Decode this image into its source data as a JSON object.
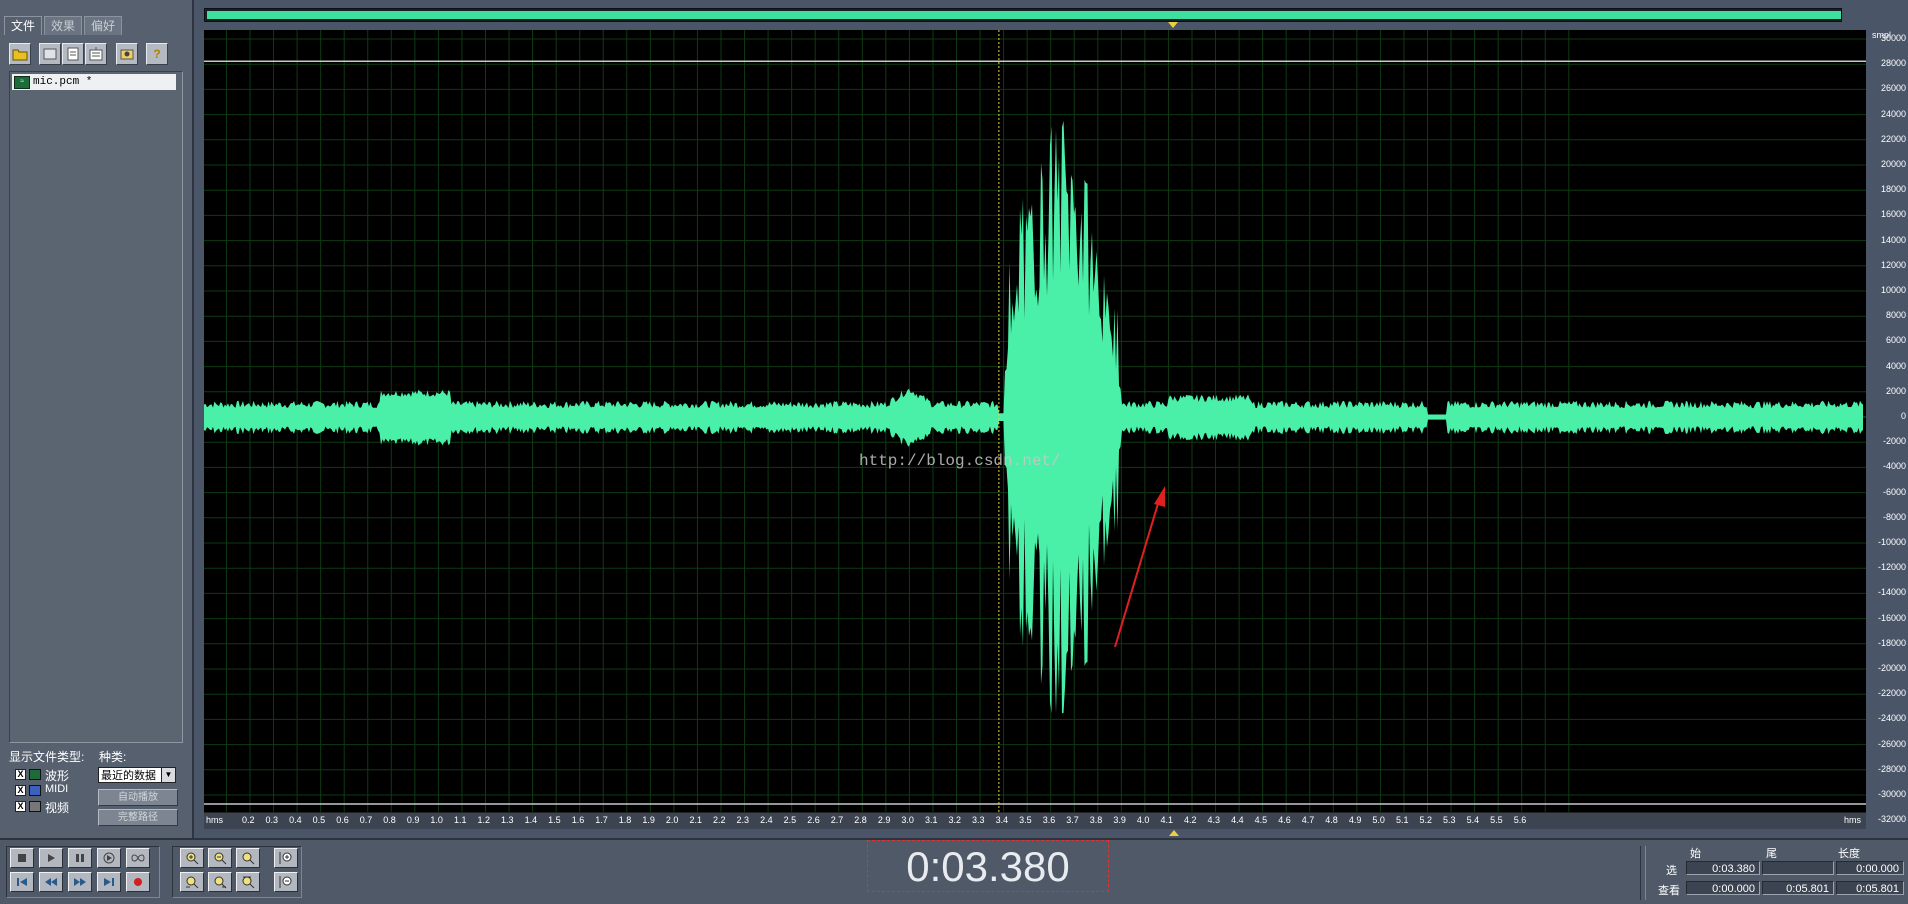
{
  "tabs": [
    "文件",
    "效果",
    "偏好"
  ],
  "toolbar_icons": [
    "open-folder-icon",
    "open-file-icon",
    "close-file-icon",
    "close-all-icon",
    "insert-icon",
    "help-icon"
  ],
  "files": [
    {
      "name": "mic.pcm *"
    }
  ],
  "filter": {
    "display_label": "显示文件类型:",
    "category_label": "种类:",
    "types": [
      {
        "label": "波形",
        "checked": "X"
      },
      {
        "label": "MIDI",
        "checked": "X"
      },
      {
        "label": "视频",
        "checked": "X"
      }
    ],
    "category_value": "最近的数据",
    "auto_play": "自动播放",
    "full_path": "完整路径"
  },
  "waveform": {
    "watermark": "http://blog.csdn.net/",
    "y_unit": "smpl",
    "y_ticks": [
      30000,
      28000,
      26000,
      24000,
      22000,
      20000,
      18000,
      16000,
      14000,
      12000,
      10000,
      8000,
      6000,
      4000,
      2000,
      0,
      -2000,
      -4000,
      -6000,
      -8000,
      -10000,
      -12000,
      -14000,
      -16000,
      -18000,
      -20000,
      -22000,
      -24000,
      -26000,
      -28000,
      -30000,
      -32000
    ],
    "x_unit": "hms",
    "x_ticks": [
      "0.2",
      "0.3",
      "0.4",
      "0.5",
      "0.6",
      "0.7",
      "0.8",
      "0.9",
      "1.0",
      "1.1",
      "1.2",
      "1.3",
      "1.4",
      "1.5",
      "1.6",
      "1.7",
      "1.8",
      "1.9",
      "2.0",
      "2.1",
      "2.2",
      "2.3",
      "2.4",
      "2.5",
      "2.6",
      "2.7",
      "2.8",
      "2.9",
      "3.0",
      "3.1",
      "3.2",
      "3.3",
      "3.4",
      "3.5",
      "3.6",
      "3.7",
      "3.8",
      "3.9",
      "4.0",
      "4.1",
      "4.2",
      "4.3",
      "4.4",
      "4.5",
      "4.6",
      "4.7",
      "4.8",
      "4.9",
      "5.0",
      "5.1",
      "5.2",
      "5.3",
      "5.4",
      "5.5",
      "5.6"
    ],
    "cursor_time": 3.38,
    "colors": {
      "wave": "#4af0a8",
      "grid": "#0f3a12",
      "cursor": "#e8d040",
      "arrow": "#e02020"
    }
  },
  "transport": [
    "stop-icon",
    "play-icon",
    "pause-icon",
    "play-to-end-icon",
    "loop-icon",
    "go-start-icon",
    "rewind-icon",
    "fast-forward-icon",
    "go-end-icon",
    "record-icon"
  ],
  "zoom": [
    "zoom-in-icon",
    "zoom-out-icon",
    "zoom-full-icon",
    "zoom-in-left-icon",
    "zoom-selection-icon",
    "zoom-in-vertical-icon",
    "zoom-out-right-icon",
    "zoom-out-vertical-icon"
  ],
  "timer": "0:03.380",
  "selection": {
    "col_start": "始",
    "col_end": "尾",
    "col_length": "长度",
    "row_select": "选",
    "row_view": "查看",
    "select_start": "0:03.380",
    "select_end": "",
    "select_length": "0:00.000",
    "view_start": "0:00.000",
    "view_end": "0:05.801",
    "view_length": "0:05.801"
  }
}
